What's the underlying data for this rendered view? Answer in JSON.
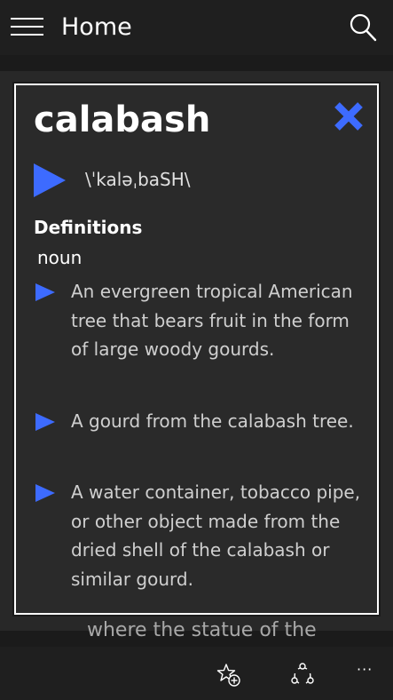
{
  "header": {
    "title": "Home",
    "menu_icon": "hamburger-icon",
    "search_icon": "search-icon"
  },
  "background": {
    "partial_text": "where the statue of the"
  },
  "popup": {
    "word": "calabash",
    "pronunciation": "\\ˈkaləˌbaSH\\",
    "definitions_heading": "Definitions",
    "part_of_speech": "noun",
    "definitions": [
      "An evergreen tropical American tree that bears fruit in the form of large woody gourds.",
      "A gourd from the calabash tree.",
      "A water container, tobacco pipe, or other object made from the dried shell of the calabash or similar gourd."
    ],
    "accent_color": "#3d6bff",
    "close_icon": "close-x-icon",
    "play_icon": "play-icon",
    "bullet_icon": "triangle-bullet-icon"
  },
  "appbar": {
    "favorite_icon": "add-favorite-icon",
    "share_icon": "share-icon",
    "more_label": "···"
  }
}
